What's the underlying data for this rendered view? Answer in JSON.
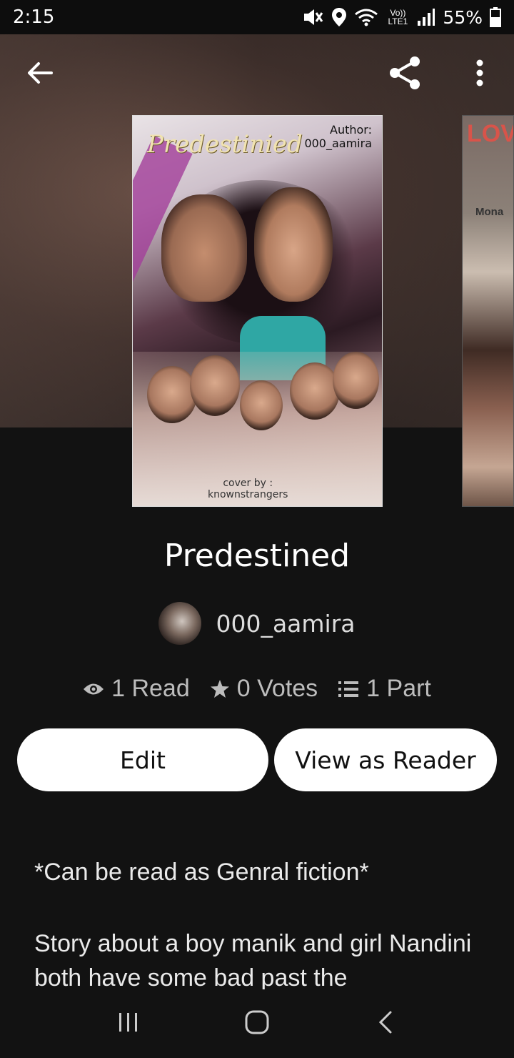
{
  "status_bar": {
    "time": "2:15",
    "network": "Vo)) LTE1",
    "battery": "55%"
  },
  "toolbar": {
    "back_icon": "arrow-left-icon",
    "share_icon": "share-icon",
    "more_icon": "more-vertical-icon"
  },
  "cover": {
    "title_art": "Predestinied",
    "author_label": "Author:",
    "author_handle": "000_aamira",
    "credit_line1": "cover by :",
    "credit_line2": "knownstrangers"
  },
  "next_cover": {
    "title_fragment": "LOV",
    "author_fragment": "Mona"
  },
  "story": {
    "title": "Predestined",
    "author": "000_aamira",
    "stats": {
      "reads": "1 Read",
      "votes": "0 Votes",
      "parts": "1 Part"
    }
  },
  "actions": {
    "edit_label": "Edit",
    "view_as_reader_label": "View as Reader"
  },
  "description": {
    "line1": "*Can be read as Genral fiction*",
    "line2": "Story about a boy manik and girl Nandini both have some bad past the"
  },
  "nav": {
    "recent_icon": "recent-apps-icon",
    "home_icon": "home-icon",
    "back_icon": "back-chevron-icon"
  }
}
